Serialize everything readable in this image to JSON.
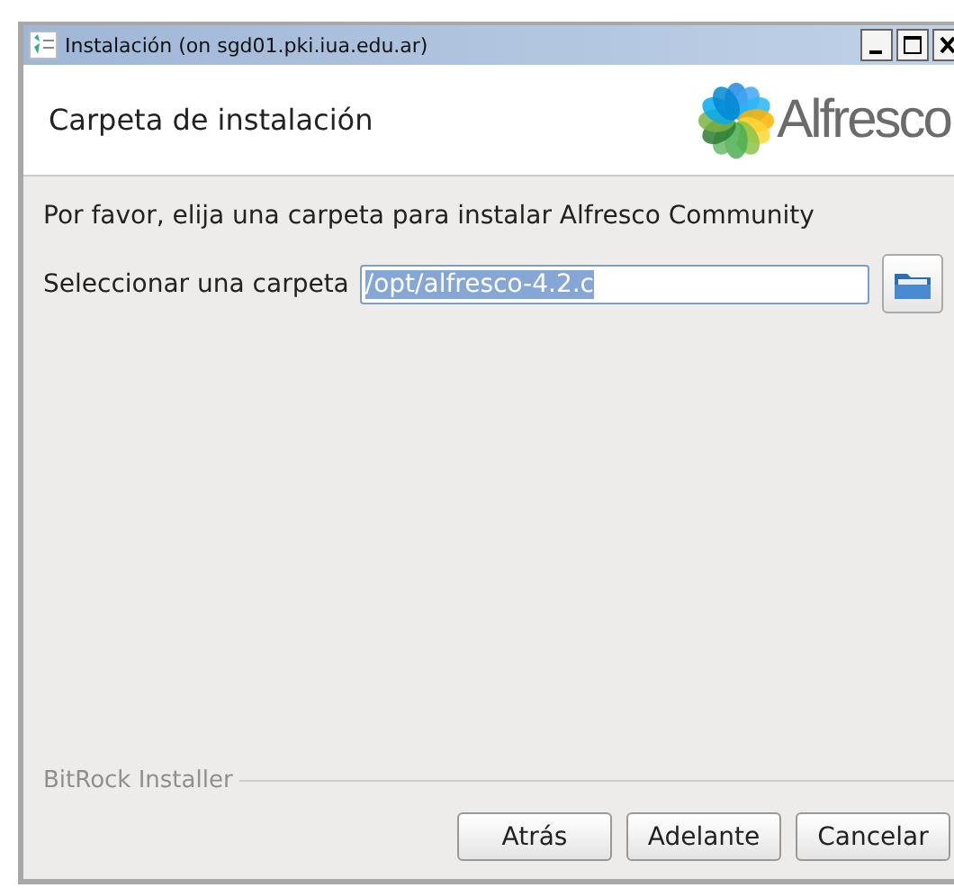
{
  "window": {
    "title": "Instalación (on sgd01.pki.iua.edu.ar)"
  },
  "header": {
    "title": "Carpeta de instalación",
    "logo_text": "Alfresco"
  },
  "instructions": "Por favor, elija una carpeta para instalar Alfresco Community",
  "folder_field": {
    "label": "Seleccionar una carpeta",
    "value": "/opt/alfresco-4.2.c",
    "selected": true
  },
  "footer": {
    "brand": "BitRock Installer"
  },
  "buttons": [
    "Atrás",
    "Adelante",
    "Cancelar"
  ]
}
